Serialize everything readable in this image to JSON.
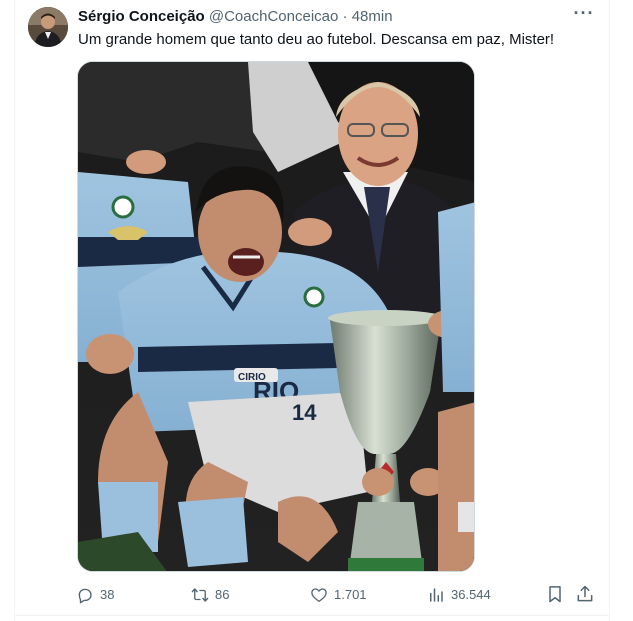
{
  "tweet": {
    "author_name": "Sérgio Conceição",
    "author_handle": "@CoachConceicao",
    "separator": "·",
    "time": "48min",
    "text": "Um grande homem que tanto deu ao futebol. Descansa em paz, Mister!",
    "more_label": "···"
  },
  "media": {
    "jersey_number": "14",
    "sponsor": "CIRIO"
  },
  "actions": {
    "replies": "38",
    "retweets": "86",
    "likes": "1.701",
    "views": "36.544"
  },
  "icons": {
    "reply": "reply-icon",
    "retweet": "retweet-icon",
    "like": "heart-icon",
    "views": "views-icon",
    "bookmark": "bookmark-icon",
    "share": "share-icon"
  },
  "colors": {
    "text_primary": "#0f1419",
    "text_secondary": "#536471",
    "border": "#cfd9de"
  }
}
